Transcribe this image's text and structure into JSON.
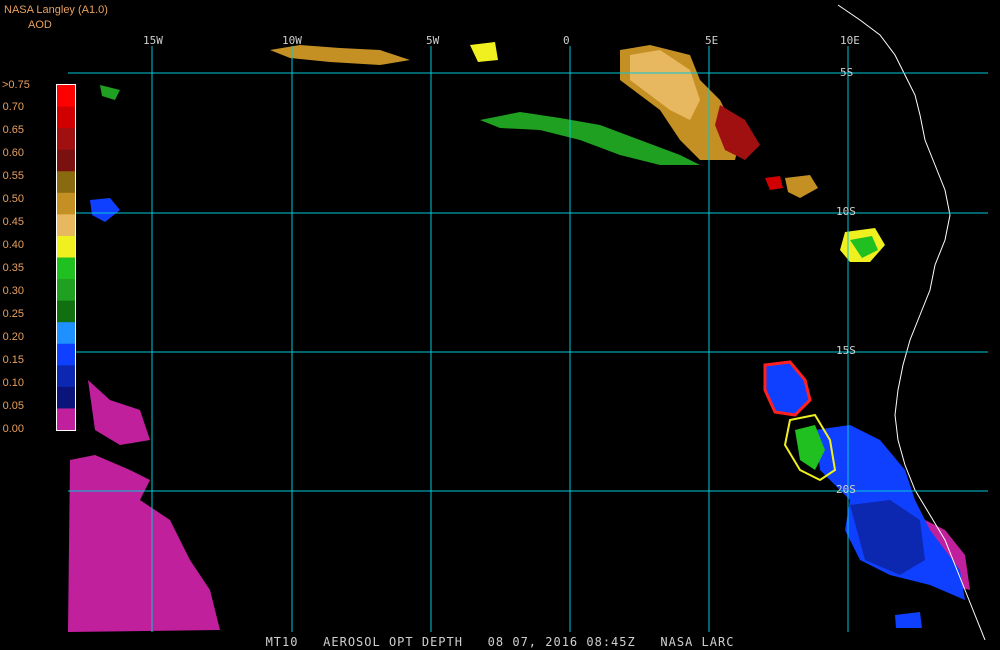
{
  "header": {
    "source": "NASA Langley (A1.0)",
    "product": "AOD"
  },
  "colorbar": {
    "labels": [
      ">0.75",
      "0.70",
      "0.65",
      "0.60",
      "0.55",
      "0.50",
      "0.45",
      "0.40",
      "0.35",
      "0.30",
      "0.25",
      "0.20",
      "0.15",
      "0.10",
      "0.05",
      "0.00"
    ],
    "colors": [
      "#ff0000",
      "#d00000",
      "#a01010",
      "#7a1010",
      "#8a6a10",
      "#c49024",
      "#e8b860",
      "#f0f020",
      "#20c020",
      "#20a020",
      "#107010",
      "#1e90ff",
      "#1040ff",
      "#0c28b0",
      "#0a147a",
      "#c0209c"
    ]
  },
  "axes": {
    "lon_labels": [
      "15W",
      "10W",
      "5W",
      "0",
      "5E",
      "10E"
    ],
    "lat_labels": [
      "5S",
      "10S",
      "15S",
      "20S"
    ]
  },
  "caption": {
    "satellite": "MT10",
    "product": "AEROSOL OPT DEPTH",
    "date": "08 07, 2016 08:45Z",
    "agency": "NASA LARC"
  }
}
